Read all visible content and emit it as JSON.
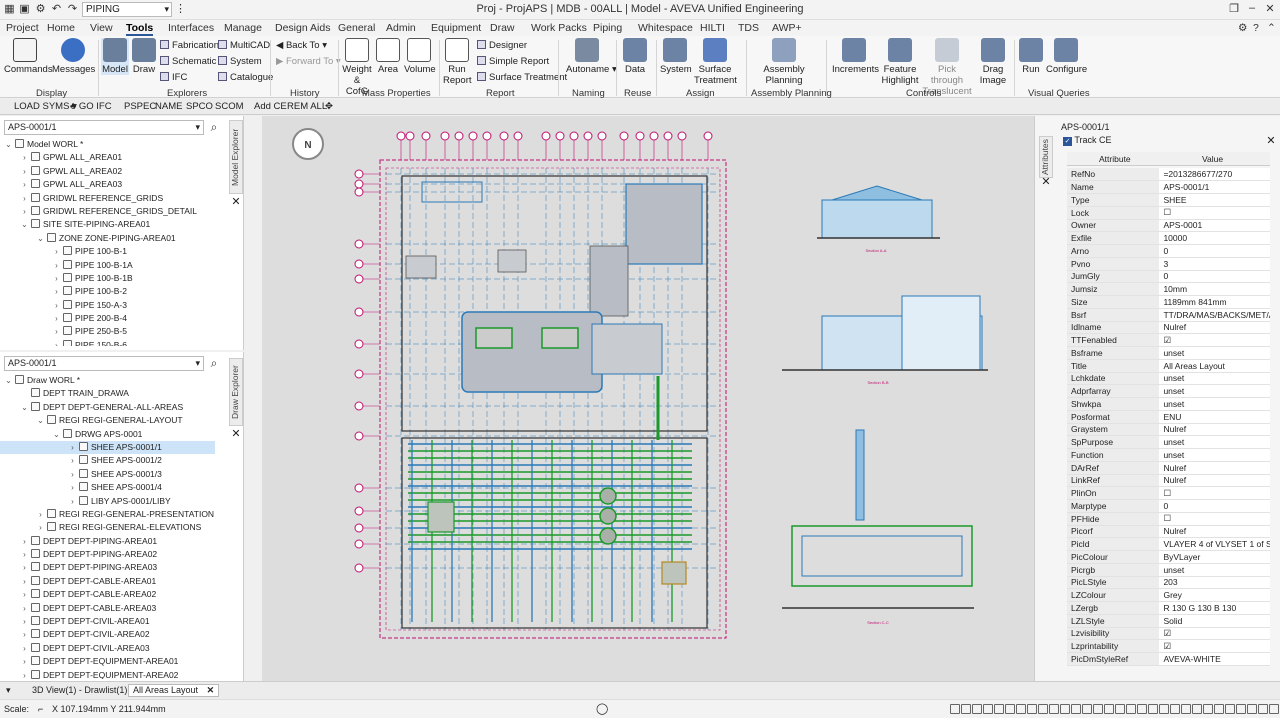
{
  "window": {
    "title": "Proj - ProjAPS | MDB - 00ALL | Model - AVEVA Unified Engineering",
    "quick_combo": "PIPING"
  },
  "menu": {
    "tabs": [
      "Project",
      "Home",
      "View",
      "Tools",
      "Interfaces",
      "Manage",
      "Design Aids",
      "General",
      "Admin",
      "Equipment",
      "Draw",
      "Work Packs",
      "Piping",
      "Whitespace",
      "HILTI",
      "TDS",
      "AWP+"
    ],
    "active": "Tools"
  },
  "ribbon": {
    "groups": [
      {
        "label": "Display",
        "large": [
          "Commands",
          "Messages"
        ]
      },
      {
        "label": "Explorers",
        "large": [
          "Model",
          "Draw"
        ],
        "small": [
          "Fabrication",
          "Schematic",
          "IFC",
          "MultiCAD",
          "System",
          "Catalogue"
        ]
      },
      {
        "label": "History",
        "small": [
          "Back To",
          "Forward To"
        ]
      },
      {
        "label": "Mass Properties",
        "large": [
          "Weight & CofG",
          "Area",
          "Volume"
        ]
      },
      {
        "label": "Report",
        "large": [
          "Run Report"
        ],
        "small": [
          "Designer",
          "Simple Report",
          "Surface Treatment"
        ]
      },
      {
        "label": "Naming",
        "large": [
          "Autoname"
        ]
      },
      {
        "label": "Reuse",
        "large": [
          "Data"
        ]
      },
      {
        "label": "Assign",
        "large": [
          "System",
          "Surface Treatment"
        ]
      },
      {
        "label": "Assembly Planning",
        "large": [
          "Assembly Planning"
        ]
      },
      {
        "label": "Controls",
        "large": [
          "Increments",
          "Feature Highlight",
          "Pick through Translucent",
          "Drag Image"
        ]
      },
      {
        "label": "Visual Queries",
        "large": [
          "Run",
          "Configure"
        ]
      }
    ]
  },
  "toolbar2": [
    "LOAD SYMS",
    "GO IFC",
    "PSPEC",
    "NAME",
    "SPCO",
    "SCOM",
    "Add CE",
    "REM ALL"
  ],
  "model_explorer": {
    "search": "APS-0001/1",
    "tab_label": "Model Explorer",
    "nodes": [
      {
        "t": "Model WORL *",
        "d": 0,
        "e": "v"
      },
      {
        "t": "GPWL ALL_AREA01",
        "d": 1,
        "e": ">"
      },
      {
        "t": "GPWL ALL_AREA02",
        "d": 1,
        "e": ">"
      },
      {
        "t": "GPWL ALL_AREA03",
        "d": 1,
        "e": ">"
      },
      {
        "t": "GRIDWL REFERENCE_GRIDS",
        "d": 1,
        "e": ">"
      },
      {
        "t": "GRIDWL REFERENCE_GRIDS_DETAIL",
        "d": 1,
        "e": ">"
      },
      {
        "t": "SITE SITE-PIPING-AREA01",
        "d": 1,
        "e": "v"
      },
      {
        "t": "ZONE ZONE-PIPING-AREA01",
        "d": 2,
        "e": "v"
      },
      {
        "t": "PIPE 100-B-1",
        "d": 3,
        "e": ">"
      },
      {
        "t": "PIPE 100-B-1A",
        "d": 3,
        "e": ">"
      },
      {
        "t": "PIPE 100-B-1B",
        "d": 3,
        "e": ">"
      },
      {
        "t": "PIPE 100-B-2",
        "d": 3,
        "e": ">"
      },
      {
        "t": "PIPE 150-A-3",
        "d": 3,
        "e": ">"
      },
      {
        "t": "PIPE 200-B-4",
        "d": 3,
        "e": ">"
      },
      {
        "t": "PIPE 250-B-5",
        "d": 3,
        "e": ">"
      },
      {
        "t": "PIPE 150-B-6",
        "d": 3,
        "e": ">"
      }
    ]
  },
  "draw_explorer": {
    "search": "APS-0001/1",
    "tab_label": "Draw Explorer",
    "nodes": [
      {
        "t": "Draw WORL *",
        "d": 0,
        "e": "v"
      },
      {
        "t": "DEPT TRAIN_DRAWA",
        "d": 1,
        "e": ""
      },
      {
        "t": "DEPT DEPT-GENERAL-ALL-AREAS",
        "d": 1,
        "e": "v"
      },
      {
        "t": "REGI REGI-GENERAL-LAYOUT",
        "d": 2,
        "e": "v"
      },
      {
        "t": "DRWG APS-0001",
        "d": 3,
        "e": "v"
      },
      {
        "t": "SHEE APS-0001/1",
        "d": 4,
        "e": ">",
        "sel": true
      },
      {
        "t": "SHEE APS-0001/2",
        "d": 4,
        "e": ">"
      },
      {
        "t": "SHEE APS-0001/3",
        "d": 4,
        "e": ">"
      },
      {
        "t": "SHEE APS-0001/4",
        "d": 4,
        "e": ">"
      },
      {
        "t": "LIBY APS-0001/LIBY",
        "d": 4,
        "e": ">"
      },
      {
        "t": "REGI REGI-GENERAL-PRESENTATION",
        "d": 2,
        "e": ">"
      },
      {
        "t": "REGI REGI-GENERAL-ELEVATIONS",
        "d": 2,
        "e": ">"
      },
      {
        "t": "DEPT DEPT-PIPING-AREA01",
        "d": 1,
        "e": ">"
      },
      {
        "t": "DEPT DEPT-PIPING-AREA02",
        "d": 1,
        "e": ">"
      },
      {
        "t": "DEPT DEPT-PIPING-AREA03",
        "d": 1,
        "e": ">"
      },
      {
        "t": "DEPT DEPT-CABLE-AREA01",
        "d": 1,
        "e": ">"
      },
      {
        "t": "DEPT DEPT-CABLE-AREA02",
        "d": 1,
        "e": ">"
      },
      {
        "t": "DEPT DEPT-CABLE-AREA03",
        "d": 1,
        "e": ">"
      },
      {
        "t": "DEPT DEPT-CIVIL-AREA01",
        "d": 1,
        "e": ">"
      },
      {
        "t": "DEPT DEPT-CIVIL-AREA02",
        "d": 1,
        "e": ">"
      },
      {
        "t": "DEPT DEPT-CIVIL-AREA03",
        "d": 1,
        "e": ">"
      },
      {
        "t": "DEPT DEPT-EQUIPMENT-AREA01",
        "d": 1,
        "e": ">"
      },
      {
        "t": "DEPT DEPT-EQUIPMENT-AREA02",
        "d": 1,
        "e": ">"
      }
    ]
  },
  "attributes": {
    "element": "APS-0001/1",
    "track_ce": "Track CE",
    "tab_label": "Attributes",
    "col_attribute": "Attribute",
    "col_value": "Value",
    "rows": [
      [
        "RefNo",
        "=2013286677/270"
      ],
      [
        "Name",
        "APS-0001/1"
      ],
      [
        "Type",
        "SHEE"
      ],
      [
        "Lock",
        "☐"
      ],
      [
        "Owner",
        "APS-0001"
      ],
      [
        "Exfile",
        "10000"
      ],
      [
        "Arno",
        "0"
      ],
      [
        "Pvno",
        "3"
      ],
      [
        "JumGly",
        "0"
      ],
      [
        "Jumsiz",
        "10mm"
      ],
      [
        "Size",
        "1189mm 841mm"
      ],
      [
        "Bsrf",
        "TT/DRA/MAS/BACKS/MET/A0"
      ],
      [
        "Idlname",
        "Nulref"
      ],
      [
        "TTFenabled",
        "☑"
      ],
      [
        "Bsframe",
        "unset"
      ],
      [
        "Title",
        "All Areas Layout"
      ],
      [
        "Lchkdate",
        "unset"
      ],
      [
        "Adprfarray",
        "unset"
      ],
      [
        "Shwkpa",
        "unset"
      ],
      [
        "Posformat",
        "ENU"
      ],
      [
        "Graystem",
        "Nulref"
      ],
      [
        "SpPurpose",
        "unset"
      ],
      [
        "Function",
        "unset"
      ],
      [
        "DArRef",
        "Nulref"
      ],
      [
        "LinkRef",
        "Nulref"
      ],
      [
        "PlinOn",
        "☐"
      ],
      [
        "Marptype",
        "0"
      ],
      [
        "PFHide",
        "☐"
      ],
      [
        "Picorf",
        "Nulref"
      ],
      [
        "Picld",
        "VLAYER 4 of VLYSET 1 of S..."
      ],
      [
        "PicColour",
        "ByVLayer"
      ],
      [
        "Picrgb",
        "unset"
      ],
      [
        "PicLStyle",
        "203"
      ],
      [
        "LZColour",
        "Grey"
      ],
      [
        "LZergb",
        "R 130 G 130 B 130"
      ],
      [
        "LZLStyle",
        "Solid"
      ],
      [
        "Lzvisibility",
        "☑"
      ],
      [
        "Lzprintability",
        "☑"
      ],
      [
        "PicDmStyleRef",
        "AVEVA-WHITE"
      ]
    ]
  },
  "canvas": {
    "north": "N",
    "view_captions": [
      "Section A-A",
      "Section B-B",
      "Section C-C"
    ],
    "colors": {
      "bg": "#dddddd",
      "frame": "#c01070",
      "pipe_green": "#1a9a2a",
      "pipe_blue": "#2a7ab8",
      "equip": "#2f7fbf"
    }
  },
  "bottom_tabs": [
    "3D View(1) - Drawlist(1)",
    "All Areas Layout"
  ],
  "status": {
    "scale_label": "Scale:",
    "coords": "X 107.194mm Y 211.944mm"
  }
}
